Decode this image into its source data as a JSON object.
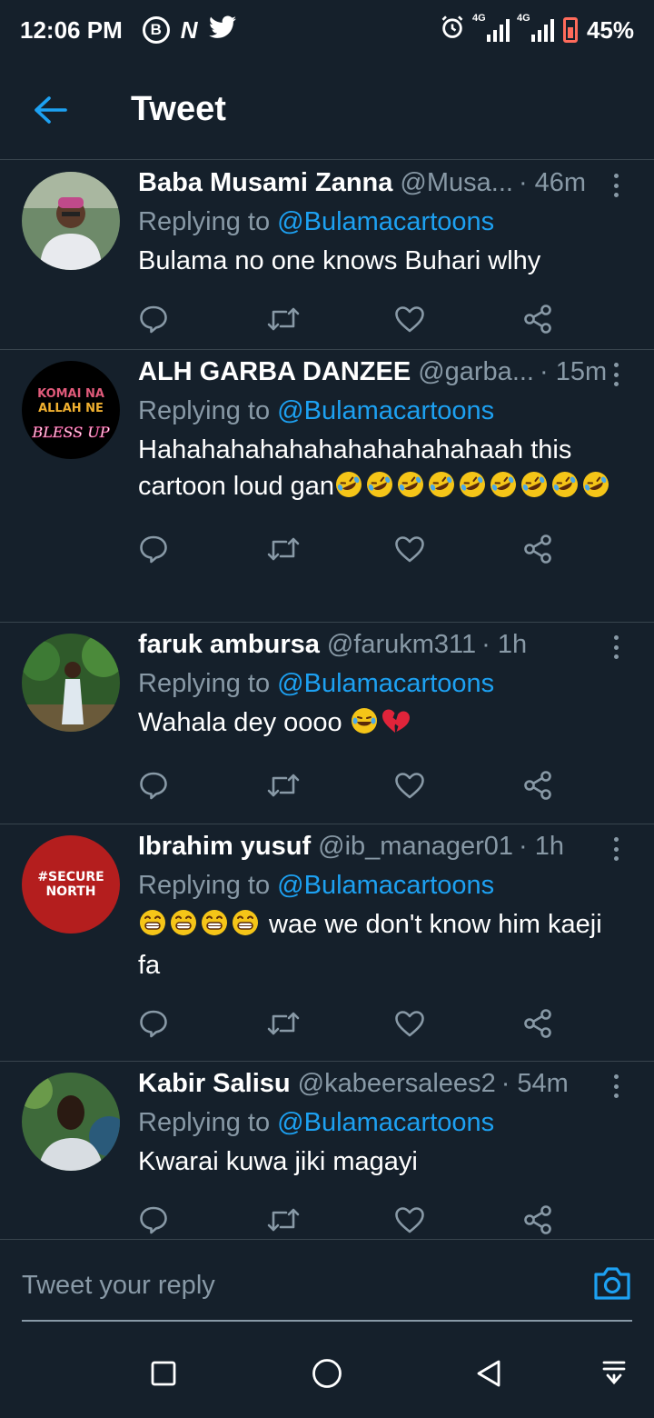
{
  "status_bar": {
    "time": "12:06 PM",
    "left_icons": [
      "b-circle-icon",
      "n-icon",
      "twitter-bird-icon"
    ],
    "n_glyph": "N",
    "b_glyph": "B",
    "network_1": "4G",
    "network_2": "4G",
    "battery": "45%"
  },
  "header": {
    "title": "Tweet",
    "back_icon": "arrow-left-icon"
  },
  "tweets": [
    {
      "name": "Baba Musami Zanna",
      "handle": "@Musa...",
      "time": "· 46m",
      "reply_prefix": "Replying to",
      "reply_to": "@Bulamacartoons",
      "text": "Bulama no one knows Buhari wlhy",
      "emoji": []
    },
    {
      "name": "ALH GARBA DANZEE",
      "handle": "@garba...",
      "time": "· 15m",
      "reply_prefix": "Replying to",
      "reply_to": "@Bulamacartoons",
      "text": "Hahahahahahahahahahahahaah this cartoon loud gan",
      "emoji": [
        "rofl",
        "rofl",
        "rofl",
        "rofl",
        "rofl",
        "rofl",
        "rofl",
        "rofl",
        "rofl"
      ],
      "avatar_text_1": "KOMAI NA",
      "avatar_text_2": "ALLAH NE",
      "avatar_text_3": "BLESS UP"
    },
    {
      "name": "faruk ambursa",
      "handle": "@farukm311",
      "time": "· 1h",
      "reply_prefix": "Replying to",
      "reply_to": "@Bulamacartoons",
      "text": "Wahala dey oooo ",
      "emoji": [
        "joy",
        "broken-heart"
      ]
    },
    {
      "name": "Ibrahim yusuf",
      "handle": "@ib_manager01",
      "time": "· 1h",
      "reply_prefix": "Replying to",
      "reply_to": "@Bulamacartoons",
      "text": " wae we don't know him kaeji fa",
      "emoji": [
        "grin",
        "grin",
        "grin",
        "grin"
      ],
      "avatar_text_1": "#SECURE",
      "avatar_text_2": "NORTH"
    },
    {
      "name": "Kabir Salisu",
      "handle": "@kabeersalees2",
      "time": "· 54m",
      "reply_prefix": "Replying to",
      "reply_to": "@Bulamacartoons",
      "text": "Kwarai kuwa jiki magayi",
      "emoji": []
    }
  ],
  "composer": {
    "placeholder": "Tweet your reply",
    "camera_icon": "camera-icon"
  },
  "nav": {
    "icons": [
      "recent-apps-square-icon",
      "home-circle-icon",
      "back-triangle-icon",
      "notification-pull-icon"
    ]
  },
  "colors": {
    "background": "#15202b",
    "accent": "#1da1f2",
    "secondary_text": "#8899a6",
    "divider": "#38444d",
    "battery_low": "#ff6b5b"
  }
}
